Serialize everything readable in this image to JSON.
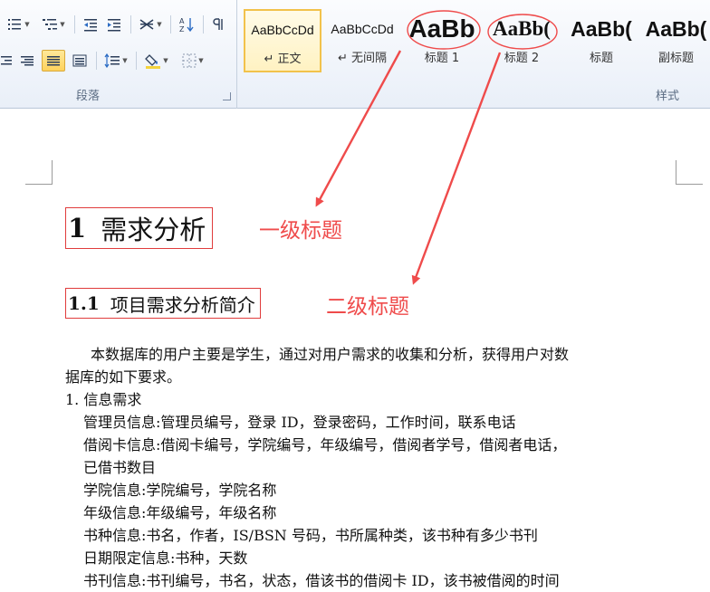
{
  "ribbon": {
    "paragraph_group": {
      "label": "段落",
      "row1": [
        "bullets-icon",
        "numbering-icon",
        "decrease-indent-icon",
        "increase-indent-icon",
        "chinese-layout-icon",
        "sort-icon",
        "show-marks-icon"
      ],
      "row2": [
        "align-right-icon",
        "justify-icon",
        "align-distributed-icon",
        "line-spacing-icon",
        "shading-icon",
        "borders-icon"
      ]
    },
    "styles_group": {
      "label": "样式",
      "items": [
        {
          "preview": "AaBbCcDd",
          "name": "↵ 正文"
        },
        {
          "preview": "AaBbCcDd",
          "name": "↵ 无间隔"
        },
        {
          "preview": "AaBb",
          "name": "标题 1"
        },
        {
          "preview": "AaBb(",
          "name": "标题 2"
        },
        {
          "preview": "AaBb(",
          "name": "标题"
        },
        {
          "preview": "AaBb(",
          "name": "副标题"
        }
      ]
    }
  },
  "document": {
    "heading1": {
      "number": "1",
      "text": "需求分析"
    },
    "heading2": {
      "number": "1.1",
      "text": "项目需求分析简介"
    },
    "annotation_level1": "一级标题",
    "annotation_level2": "二级标题",
    "paragraphs": [
      "本数据库的用户主要是学生，通过对用户需求的收集和分析，获得用户对数",
      "据库的如下要求。",
      "1. 信息需求",
      "管理员信息:管理员编号，登录 ID，登录密码，工作时间，联系电话",
      "借阅卡信息:借阅卡编号，学院编号，年级编号，借阅者学号，借阅者电话，",
      "已借书数目",
      "学院信息:学院编号，学院名称",
      "年级信息:年级编号，年级名称",
      "书种信息:书名，作者，IS/BSN 号码，书所属种类，该书种有多少书刊",
      "日期限定信息:书种，天数",
      "书刊信息:书刊编号，书名，状态，借该书的借阅卡 ID，该书被借阅的时间"
    ]
  },
  "colors": {
    "annotation": "#ef4b4b",
    "selected_style": "#f2c24b",
    "ribbon_bg": "#e9eff8"
  }
}
